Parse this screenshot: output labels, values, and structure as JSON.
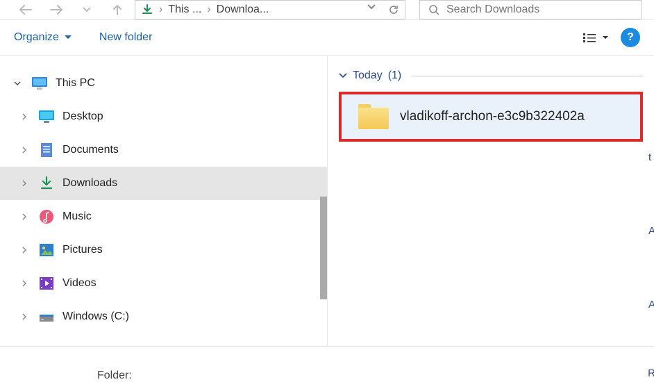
{
  "toolbar": {
    "address": {
      "node1": "This ...",
      "node2": "Downloa..."
    },
    "search_placeholder": "Search Downloads"
  },
  "command_bar": {
    "organize": "Organize",
    "new_folder": "New folder"
  },
  "sidebar": {
    "root": "This PC",
    "items": [
      {
        "label": "Desktop"
      },
      {
        "label": "Documents"
      },
      {
        "label": "Downloads"
      },
      {
        "label": "Music"
      },
      {
        "label": "Pictures"
      },
      {
        "label": "Videos"
      },
      {
        "label": "Windows (C:)"
      }
    ]
  },
  "content": {
    "group_label": "Today",
    "group_count": "(1)",
    "files": [
      {
        "name": "vladikoff-archon-e3c9b322402a"
      }
    ]
  },
  "bottom": {
    "folder_label": "Folder:"
  }
}
